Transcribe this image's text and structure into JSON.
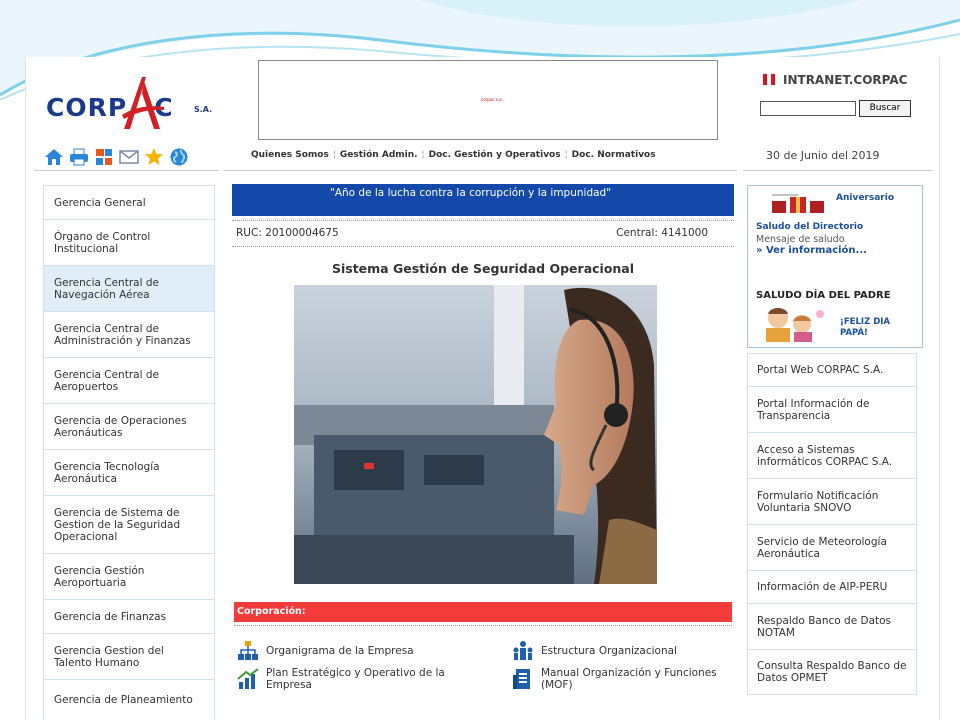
{
  "header": {
    "logo_text": "CORP",
    "logo_text2": "C",
    "logo_suffix": "S.A.",
    "banner_caption": "corpac s.a.",
    "intranet_label": "INTRANET.CORPAC",
    "search_placeholder": "",
    "search_button": "Buscar",
    "date": "30 de Junio del 2019"
  },
  "icons": [
    "home-icon",
    "printer-icon",
    "sitemap-icon",
    "mail-icon",
    "star-icon",
    "globe-icon"
  ],
  "topnav": [
    "Quienes Somos",
    "Gestión Admin.",
    "Doc. Gestión y Operativos",
    "Doc. Normativos"
  ],
  "topnav_sep": "¦",
  "left_menu": [
    {
      "label": "Gerencia General",
      "active": false
    },
    {
      "label": "Órgano de Control Institucional",
      "active": false
    },
    {
      "label": "Gerencia Central de Navegación Aérea",
      "active": true
    },
    {
      "label": "Gerencia Central de Administración y Finanzas",
      "active": false
    },
    {
      "label": "Gerencia Central de Aeropuertos",
      "active": false
    },
    {
      "label": "Gerencia de Operaciones Aeronáuticas",
      "active": false
    },
    {
      "label": "Gerencia Tecnología Aeronáutica",
      "active": false
    },
    {
      "label": "Gerencia de Sistema de Gestion de la Seguridad Operacional",
      "active": false
    },
    {
      "label": "Gerencia Gestión Aeroportuaria",
      "active": false
    },
    {
      "label": "Gerencia de Finanzas",
      "active": false
    },
    {
      "label": "Gerencia Gestion del Talento Humano",
      "active": false
    },
    {
      "label": "Gerencia de Planeamiento",
      "active": false
    }
  ],
  "main": {
    "motto": "\"Año de la lucha contra la corrupción y la impunidad\"",
    "ruc": "RUC: 20100004675",
    "central": "Central: 4141000",
    "section_title": "Sistema Gestión de Seguridad Operacional",
    "corp_title": "Corporación:",
    "links": [
      {
        "label": "Organigrama de la Empresa",
        "icon": "org-chart-icon"
      },
      {
        "label": "Estructura Organizacional",
        "icon": "people-structure-icon"
      },
      {
        "label": "Plan Estratégico y Operativo de la Empresa",
        "icon": "growth-chart-icon"
      },
      {
        "label": "Manual Organización y Funciones (MOF)",
        "icon": "manual-icon"
      }
    ]
  },
  "right_box": {
    "anniversary": "Aniversario",
    "saludo_directorio": "Saludo del Directorio",
    "mensaje": "Mensaje de saludo",
    "ver_info": "» Ver información...",
    "saludo_padre": "SALUDO DÍA DEL PADRE",
    "feliz_1": "¡FELIZ DIA",
    "feliz_2": "PAPÁ!"
  },
  "right_menu": [
    "Portal Web CORPAC S.A.",
    "Portal Información de Transparencia",
    "Acceso a Sistemas informáticos CORPAC S.A.",
    "Formulario Notificación Voluntaria SNOVO",
    "Servicio de Meteorología Aeronáutica",
    "Información de AIP-PERU",
    "Respaldo Banco de Datos NOTAM",
    "Consulta Respaldo Banco de Datos OPMET"
  ],
  "colors": {
    "brand_blue": "#1b3a8a",
    "motto_blue": "#1549a9",
    "corp_red": "#f33b3b",
    "menu_border": "#cfe0ef"
  }
}
